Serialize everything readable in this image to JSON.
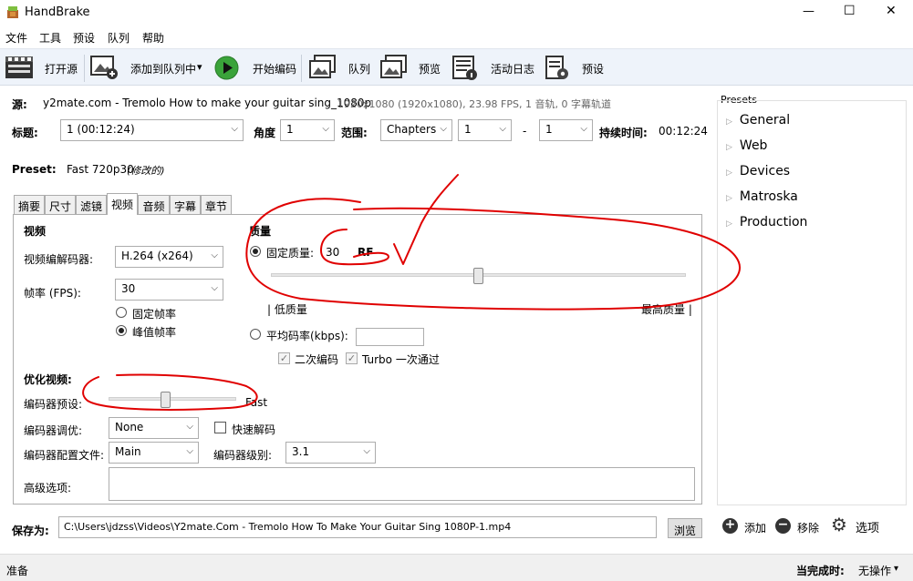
{
  "window": {
    "title": "HandBrake",
    "minimize": "—",
    "maximize": "☐",
    "close": "✕"
  },
  "menu": [
    "文件",
    "工具",
    "预设",
    "队列",
    "帮助"
  ],
  "toolbar": {
    "open_source": "打开源",
    "add_to_queue": "添加到队列中",
    "add_dropdown": "▾",
    "start_encode": "开始编码",
    "queue": "队列",
    "preview": "预览",
    "activity_log": "活动日志",
    "presets": "预设"
  },
  "source": {
    "label": "源:",
    "name": "y2mate.com - Tremolo How to make your guitar sing_1080p",
    "info": "1920x1080 (1920x1080), 23.98 FPS, 1 音轨, 0 字幕轨道"
  },
  "title_row": {
    "title_label": "标题:",
    "title_value": "1  (00:12:24)",
    "angle_label": "角度",
    "angle_value": "1",
    "range_label": "范围:",
    "range_type": "Chapters",
    "range_start": "1",
    "range_dash": "-",
    "range_end": "1",
    "duration_label": "持续时间:",
    "duration_value": "00:12:24"
  },
  "preset_row": {
    "label": "Preset:",
    "value": "Fast 720p30",
    "modified": "(修改的)"
  },
  "tabs": [
    "摘要",
    "尺寸",
    "滤镜",
    "视频",
    "音频",
    "字幕",
    "章节"
  ],
  "active_tab": "视频",
  "video": {
    "section": "视频",
    "codec_label": "视频编解码器:",
    "codec_value": "H.264 (x264)",
    "fps_label": "帧率 (FPS):",
    "fps_value": "30",
    "constant_fr": "固定帧率",
    "peak_fr": "峰值帧率"
  },
  "quality": {
    "section": "质量",
    "cq_label": "固定质量:",
    "cq_value": "30",
    "cq_unit": "RF",
    "slider_level": 0.5,
    "low_label": "| 低质量",
    "high_label": "最高质量 |",
    "abr_label": "平均码率(kbps):",
    "abr_value": "",
    "two_pass": "二次编码",
    "turbo": "Turbo 一次通过",
    "check_mark": "✓"
  },
  "optimize": {
    "section": "优化视频:",
    "preset_label": "编码器预设:",
    "preset_slider_level": 0.45,
    "preset_value": "Fast",
    "tune_label": "编码器调优:",
    "tune_value": "None",
    "fast_decode": "快速解码",
    "profile_label": "编码器配置文件:",
    "profile_value": "Main",
    "level_label": "编码器级别:",
    "level_value": "3.1",
    "advanced_label": "高级选项:",
    "advanced_value": ""
  },
  "save": {
    "label": "保存为:",
    "path": "C:\\Users\\jdzss\\Videos\\Y2mate.Com - Tremolo How To Make Your Guitar Sing 1080P-1.mp4",
    "browse": "浏览"
  },
  "presets_panel": {
    "title": "Presets",
    "items": [
      "General",
      "Web",
      "Devices",
      "Matroska",
      "Production"
    ],
    "add": "添加",
    "remove": "移除",
    "options": "选项",
    "add_glyph": "+",
    "remove_glyph": "−",
    "options_glyph": "⚙"
  },
  "status": {
    "left": "准备",
    "when_done_label": "当完成时:",
    "when_done_value": "无操作"
  },
  "colors": {
    "annotation": "#e00000",
    "play": "#3aa33a",
    "toolbar_bg": "#eef3fa"
  }
}
